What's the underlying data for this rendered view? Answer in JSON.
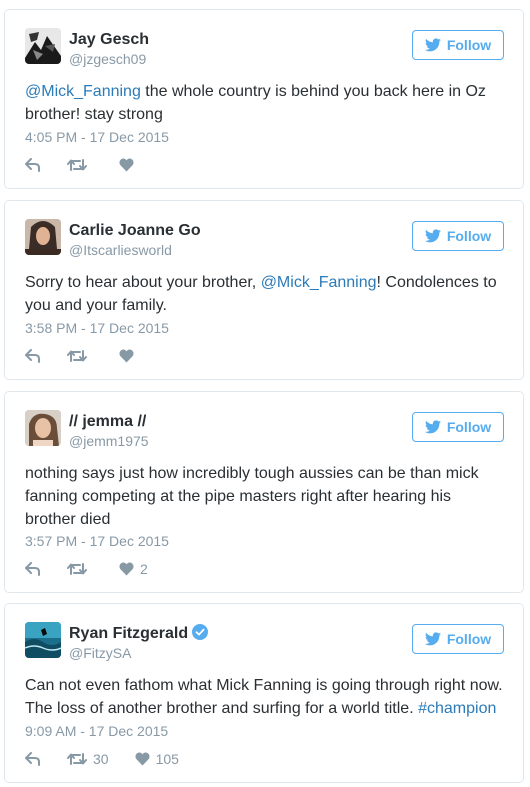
{
  "follow_label": "Follow",
  "colors": {
    "accent": "#55acee",
    "link": "#2b7bb9",
    "muted": "#8899a6",
    "text": "#292f33",
    "border": "#e1e8ed"
  },
  "tweets": [
    {
      "name": "Jay Gesch",
      "handle": "@jzgesch09",
      "verified": false,
      "segments": [
        {
          "text": "@Mick_Fanning",
          "link": true
        },
        {
          "text": " the whole country is behind you back here in Oz brother! stay strong",
          "link": false
        }
      ],
      "timestamp": "4:05 PM - 17 Dec 2015",
      "retweets": "",
      "likes": ""
    },
    {
      "name": "Carlie Joanne Go",
      "handle": "@Itscarliesworld",
      "verified": false,
      "segments": [
        {
          "text": "Sorry to hear about your brother, ",
          "link": false
        },
        {
          "text": "@Mick_Fanning",
          "link": true
        },
        {
          "text": "! Condolences to you and your family.",
          "link": false
        }
      ],
      "timestamp": "3:58 PM - 17 Dec 2015",
      "retweets": "",
      "likes": ""
    },
    {
      "name": "// jemma //",
      "handle": "@jemm1975",
      "verified": false,
      "segments": [
        {
          "text": "nothing says just how incredibly tough aussies can be than mick fanning competing at the pipe masters right after hearing his brother died",
          "link": false
        }
      ],
      "timestamp": "3:57 PM - 17 Dec 2015",
      "retweets": "",
      "likes": "2"
    },
    {
      "name": "Ryan Fitzgerald",
      "handle": "@FitzySA",
      "verified": true,
      "segments": [
        {
          "text": "Can not even fathom what Mick Fanning is going through right now. The loss of another brother and surfing for a world title. ",
          "link": false
        },
        {
          "text": "#champion",
          "link": true
        }
      ],
      "timestamp": "9:09 AM - 17 Dec 2015",
      "retweets": "30",
      "likes": "105"
    }
  ]
}
